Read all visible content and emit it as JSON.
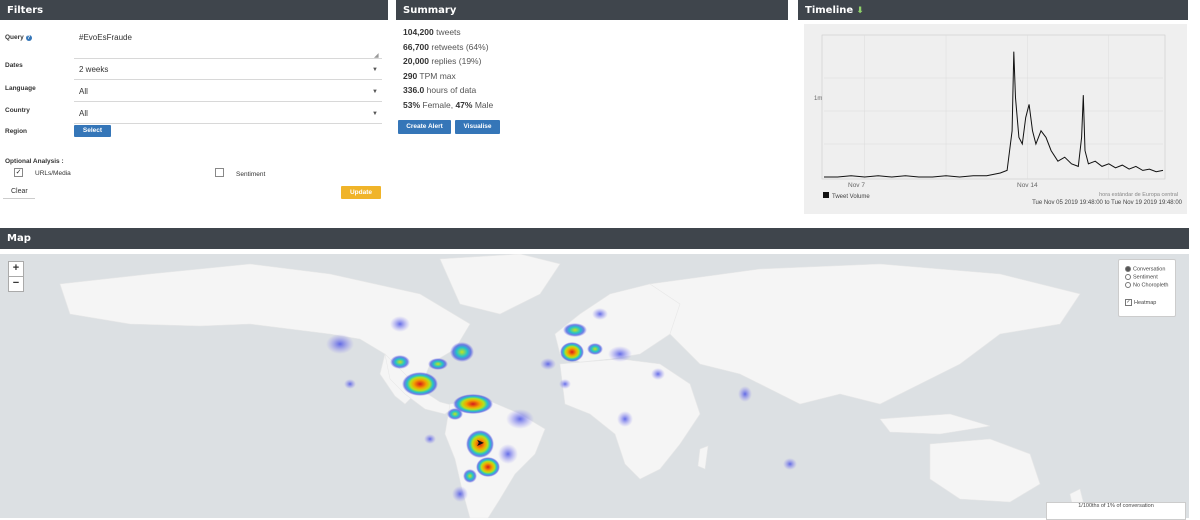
{
  "filters": {
    "title": "Filters",
    "query_label": "Query",
    "query_value": "#EvoEsFraude",
    "dates_label": "Dates",
    "dates_value": "2 weeks",
    "language_label": "Language",
    "language_value": "All",
    "country_label": "Country",
    "country_value": "All",
    "region_label": "Region",
    "region_button": "Select",
    "optional_label": "Optional Analysis :",
    "urls_media_label": "URLs/Media",
    "urls_media_checked": true,
    "sentiment_label": "Sentiment",
    "sentiment_checked": false,
    "clear_button": "Clear",
    "update_button": "Update",
    "help_icon": "question-circle-icon"
  },
  "summary": {
    "title": "Summary",
    "rows": [
      {
        "value": "104,200",
        "text": " tweets"
      },
      {
        "value": "66,700",
        "text": " retweets (64%)"
      },
      {
        "value": "20,000",
        "text": " replies (19%)"
      },
      {
        "value": "290",
        "text": " TPM max"
      },
      {
        "value": "336.0",
        "text": " hours of data"
      }
    ],
    "gender_female_pct": "53%",
    "gender_female_label": " Female, ",
    "gender_male_pct": "47%",
    "gender_male_label": " Male",
    "create_alert_button": "Create Alert",
    "visualise_button": "Visualise"
  },
  "timeline": {
    "title": "Timeline",
    "download_icon": "download-icon",
    "y_tick": "1m",
    "x_ticks": [
      "Nov 7",
      "Nov 14"
    ],
    "legend_label": "Tweet Volume",
    "timezone_note": "hora estándar de Europa central",
    "range_start": "Tue Nov 05 2019 19:48:00",
    "range_to": "to",
    "range_end": "Tue Nov 19 2019 19:48:00"
  },
  "map": {
    "title": "Map",
    "zoom_in": "+",
    "zoom_out": "−",
    "layers": {
      "conversation": "Conversation",
      "sentiment": "Sentiment",
      "no_choropleth": "No Choropleth",
      "heatmap": "Heatmap",
      "selected": "Conversation",
      "heatmap_checked": true
    },
    "legend_text": "1/100ths of 1% of conversation"
  },
  "chart_data": {
    "type": "line",
    "title": "",
    "xlabel": "",
    "ylabel": "",
    "x_tick_labels": [
      "Nov 7",
      "Nov 14"
    ],
    "y_tick_labels": [
      "1m"
    ],
    "series": [
      {
        "name": "Tweet Volume",
        "color": "#111111",
        "x": [
          0,
          0.04,
          0.08,
          0.12,
          0.16,
          0.2,
          0.24,
          0.28,
          0.32,
          0.36,
          0.4,
          0.44,
          0.48,
          0.5,
          0.52,
          0.54,
          0.555,
          0.56,
          0.565,
          0.575,
          0.585,
          0.595,
          0.605,
          0.615,
          0.625,
          0.64,
          0.655,
          0.67,
          0.69,
          0.71,
          0.73,
          0.75,
          0.76,
          0.765,
          0.77,
          0.78,
          0.8,
          0.82,
          0.84,
          0.86,
          0.88,
          0.9,
          0.92,
          0.94,
          0.96,
          0.98,
          1
        ],
        "y": [
          0,
          0,
          0.01,
          0,
          0.01,
          0,
          0.01,
          0,
          0,
          0.01,
          0,
          0.01,
          0.01,
          0.02,
          0.03,
          0.05,
          0.35,
          0.95,
          0.6,
          0.3,
          0.25,
          0.45,
          0.55,
          0.35,
          0.25,
          0.35,
          0.3,
          0.2,
          0.12,
          0.15,
          0.1,
          0.08,
          0.3,
          0.62,
          0.2,
          0.1,
          0.12,
          0.08,
          0.1,
          0.07,
          0.09,
          0.06,
          0.08,
          0.05,
          0.06,
          0.04,
          0.05
        ]
      }
    ],
    "grid": true,
    "legend": "bottom-left"
  }
}
